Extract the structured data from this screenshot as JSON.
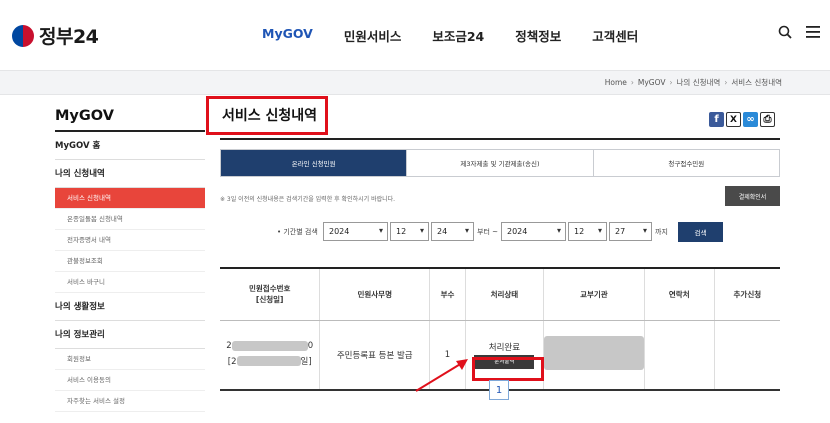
{
  "header": {
    "logo_text": "정부24",
    "nav": [
      {
        "label": "MyGOV",
        "active": true
      },
      {
        "label": "민원서비스",
        "active": false
      },
      {
        "label": "보조금24",
        "active": false
      },
      {
        "label": "정책정보",
        "active": false
      },
      {
        "label": "고객센터",
        "active": false
      }
    ],
    "accent_color": "#1f55b5"
  },
  "breadcrumb": [
    "Home",
    "MyGOV",
    "나의 신청내역",
    "서비스 신청내역"
  ],
  "sidebar": {
    "title": "MyGOV",
    "items": [
      {
        "label": "MyGOV 홈",
        "type": "group"
      },
      {
        "label": "나의 신청내역",
        "type": "group"
      },
      {
        "label": "서비스 신청내역",
        "type": "sub",
        "active": true
      },
      {
        "label": "온종일돌봄 신청내역",
        "type": "sub"
      },
      {
        "label": "전자증명서 내역",
        "type": "sub"
      },
      {
        "label": "관불정보조회",
        "type": "sub"
      },
      {
        "label": "서비스 바구니",
        "type": "sub"
      },
      {
        "label": "나의 생활정보",
        "type": "group"
      },
      {
        "label": "나의 정보관리",
        "type": "group"
      },
      {
        "label": "회원정보",
        "type": "sub"
      },
      {
        "label": "서비스 이용동의",
        "type": "sub"
      },
      {
        "label": "자주찾는 서비스 설정",
        "type": "sub"
      }
    ],
    "active_color": "#e8453b"
  },
  "main": {
    "title": "서비스 신청내역",
    "share_icons": [
      "facebook-icon",
      "x-icon",
      "link-icon",
      "print-icon"
    ],
    "tabs": [
      {
        "label": "온라인 신청민원",
        "active": true
      },
      {
        "label": "제3자제출 및 기관제출(송신)",
        "active": false
      },
      {
        "label": "청구접수민원",
        "active": false
      }
    ],
    "notice": "※ 3일 이전의 신청내용은 검색기간을 입력한 후 확인하시기 바랍니다.",
    "cert_button": "결제확인서",
    "search": {
      "label": "• 기간별 검색",
      "from": {
        "year": "2024",
        "month": "12",
        "day": "24"
      },
      "from_suffix": "부터 ~",
      "to": {
        "year": "2024",
        "month": "12",
        "day": "27"
      },
      "to_suffix": "까지",
      "button": "검색"
    },
    "table": {
      "headers": [
        "민원접수번호\n[신청일]",
        "민원사무명",
        "부수",
        "처리상태",
        "교부기관",
        "연락처",
        "추가신청"
      ],
      "rows": [
        {
          "receipt_prefix": "2",
          "receipt_suffix": "0",
          "date_prefix": "[2",
          "date_suffix": "일]",
          "service": "주민등록표 등본 발급",
          "copies": "1",
          "status": "처리완료",
          "status_button": "문서출력",
          "office": "",
          "contact": "",
          "extra": ""
        }
      ]
    },
    "pagination": {
      "current": "1"
    }
  },
  "annotation_color": "#e0101b"
}
